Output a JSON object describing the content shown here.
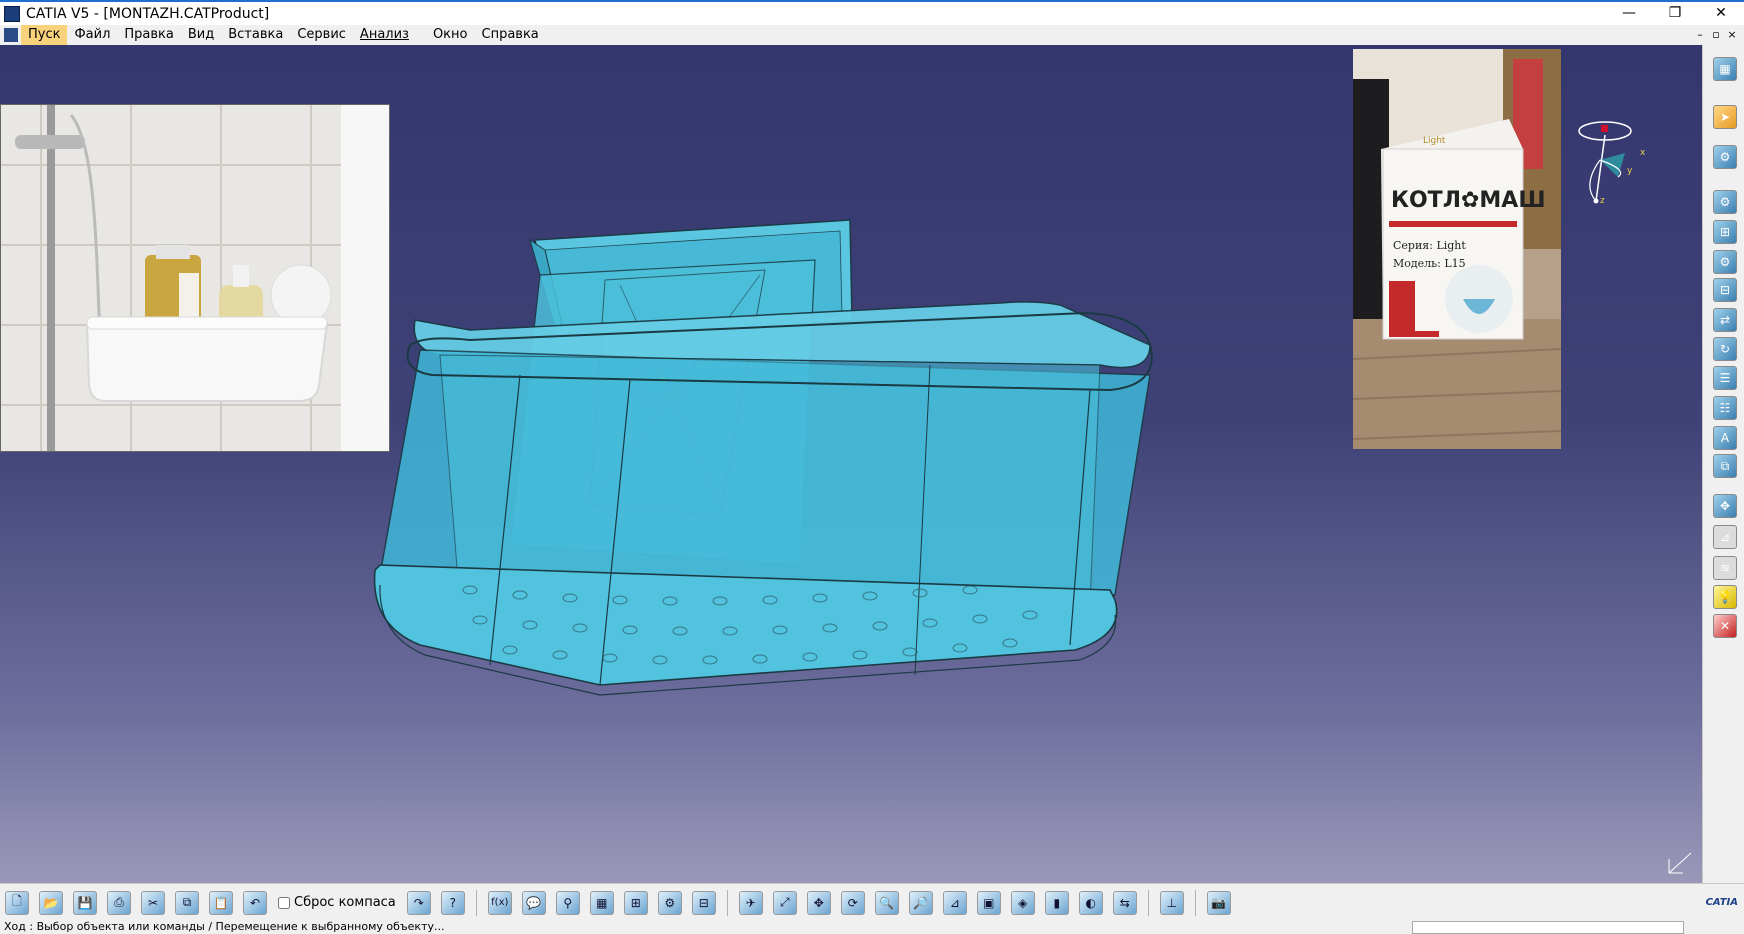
{
  "window": {
    "title": "CATIA V5 - [MONTAZH.CATProduct]",
    "minimize": "—",
    "restore": "❐",
    "close": "✕"
  },
  "menu": {
    "items": [
      "Пуск",
      "Файл",
      "Правка",
      "Вид",
      "Вставка",
      "Сервис",
      "Анализ",
      "Окно",
      "Справка"
    ],
    "mdi_buttons": [
      "–",
      "▫",
      "×"
    ]
  },
  "photo_box": {
    "brand": "КОТЛ✿МАШ",
    "series": "Серия: Light",
    "model": "Модель: L15",
    "badge": "Light"
  },
  "compass": {
    "x_label": "x",
    "y_label": "y",
    "z_label": "z"
  },
  "bottom_toolbar": {
    "compass_reset_label": "Сброс компаса",
    "fx_label": "f(x)"
  },
  "logo": {
    "text": "CATIA"
  },
  "status": {
    "text": "Ход : Выбор объекта или команды  / Перемещение к выбранному объекту..."
  },
  "colors": {
    "viewport_top": "#34366e",
    "viewport_bottom": "#9a98b8",
    "model_fill": "#3fb8d8",
    "model_edge": "#1b3a44",
    "menu_active": "#f9d27c"
  }
}
